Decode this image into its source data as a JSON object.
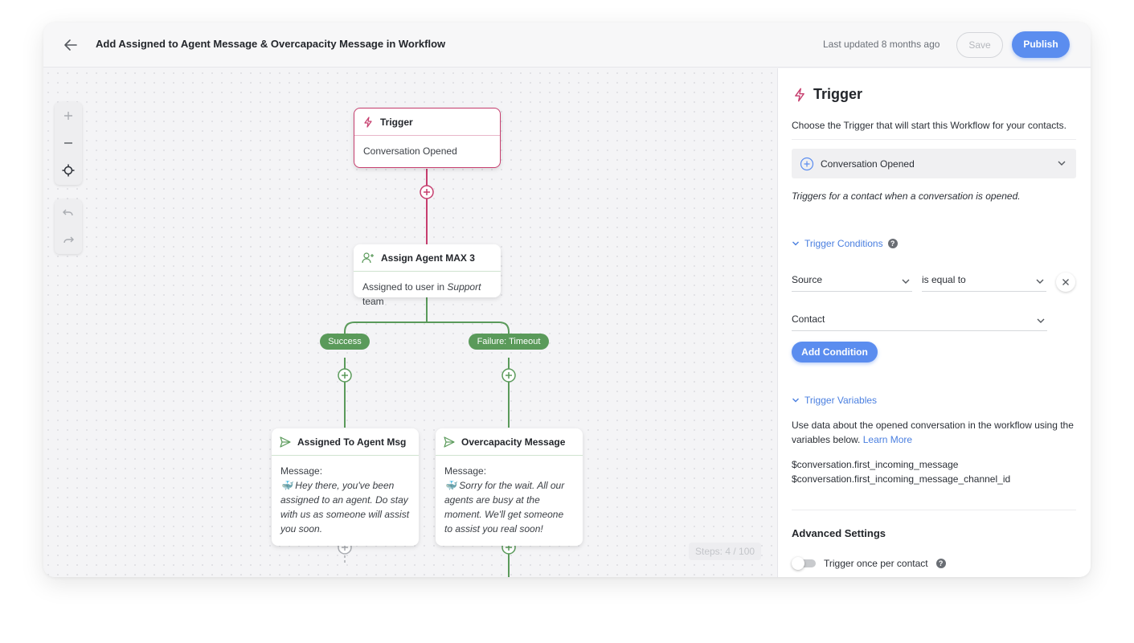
{
  "header": {
    "title": "Add Assigned to Agent Message & Overcapacity Message in Workflow",
    "last_updated": "Last updated 8 months ago",
    "save_label": "Save",
    "publish_label": "Publish"
  },
  "canvas": {
    "steps_counter": "Steps: 4 / 100",
    "nodes": {
      "trigger": {
        "title": "Trigger",
        "body": "Conversation Opened"
      },
      "assign": {
        "title": "Assign Agent MAX 3",
        "body_prefix": "Assigned to user in ",
        "body_team": "Support",
        "body_suffix": "team"
      },
      "assigned_msg": {
        "title": "Assigned To Agent Msg",
        "label": "Message:",
        "text": "🐳 Hey there, you've been assigned to an agent. Do stay with us as someone will assist you soon."
      },
      "overcapacity_msg": {
        "title": "Overcapacity Message",
        "label": "Message:",
        "text": "🐳 Sorry for the wait. All our agents are busy at the moment. We'll get someone to assist you real soon!"
      }
    },
    "branches": {
      "success": "Success",
      "failure": "Failure: Timeout"
    }
  },
  "panel": {
    "title": "Trigger",
    "description": "Choose the Trigger that will start this Workflow for your contacts.",
    "selected_trigger": "Conversation Opened",
    "trigger_note": "Triggers for a contact when a conversation is opened.",
    "conditions_label": "Trigger Conditions",
    "condition": {
      "field": "Source",
      "operator": "is equal to",
      "value": "Contact"
    },
    "add_condition_label": "Add Condition",
    "variables_label": "Trigger Variables",
    "variables_desc": "Use data about the opened conversation in the workflow using the variables below.",
    "learn_more": "Learn More",
    "variables": [
      "$conversation.first_incoming_message",
      "$conversation.first_incoming_message_channel_id"
    ],
    "advanced_title": "Advanced Settings",
    "trigger_once_label": "Trigger once per contact",
    "trigger_once_enabled": false
  },
  "colors": {
    "accent": "#5b8def",
    "trigger": "#c63e6e",
    "branch_green": "#5a9a5a"
  }
}
